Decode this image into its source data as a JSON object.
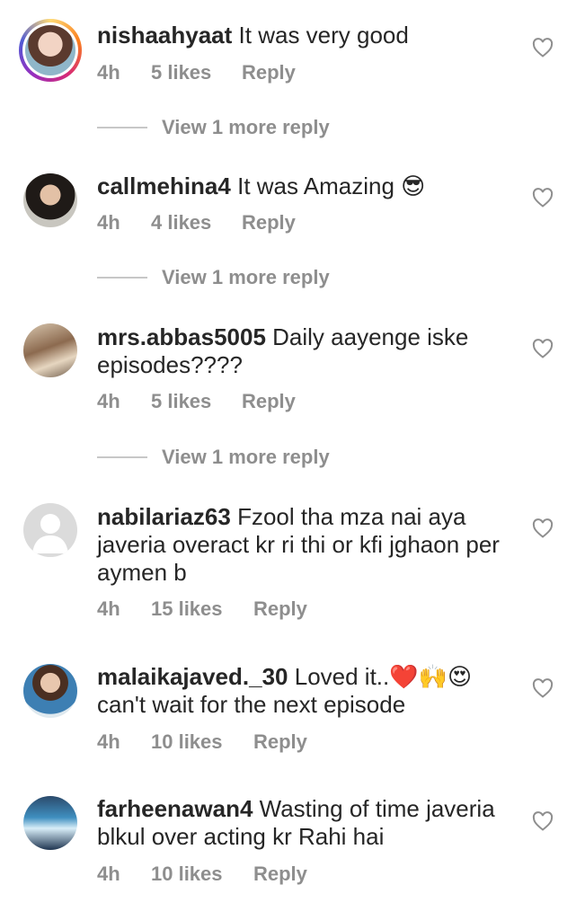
{
  "comments": [
    {
      "username": "nishaahyaat",
      "text": "It was very good",
      "time": "4h",
      "likes": "5 likes",
      "reply": "Reply"
    },
    {
      "username": "callmehina4",
      "text": "It was Amazing 😎",
      "time": "4h",
      "likes": "4 likes",
      "reply": "Reply"
    },
    {
      "username": "mrs.abbas5005",
      "text": "Daily aayenge iske episodes????",
      "time": "4h",
      "likes": "5 likes",
      "reply": "Reply"
    },
    {
      "username": "nabilariaz63",
      "text": "Fzool tha mza nai aya javeria overact kr ri thi or kfi jghaon per aymen b",
      "time": "4h",
      "likes": "15 likes",
      "reply": "Reply"
    },
    {
      "username": "malaikajaved._30",
      "text": "Loved it..❤️🙌😍 can't wait for the next episode",
      "time": "4h",
      "likes": "10 likes",
      "reply": "Reply"
    },
    {
      "username": "farheenawan4",
      "text": "Wasting of time  javeria blkul over acting kr Rahi hai",
      "time": "4h",
      "likes": "10 likes",
      "reply": "Reply"
    }
  ],
  "more_replies": {
    "label": "View 1 more reply"
  },
  "icons": {
    "like": "heart-outline-icon"
  },
  "colors": {
    "text": "#262626",
    "muted": "#8e8e8e",
    "line": "#c7c7c7"
  }
}
